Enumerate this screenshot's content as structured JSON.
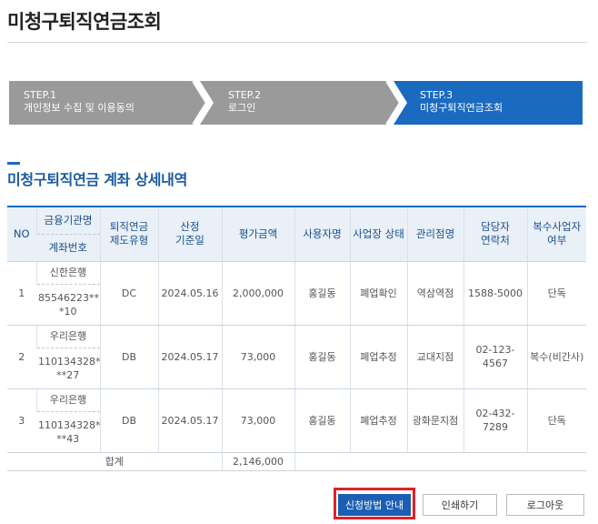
{
  "page": {
    "title": "미청구퇴직연금조회"
  },
  "steps": [
    {
      "num": "STEP.1",
      "label": "개인정보 수집 및 이용동의",
      "active": false
    },
    {
      "num": "STEP.2",
      "label": "로그인",
      "active": false
    },
    {
      "num": "STEP.3",
      "label": "미청구퇴직연금조회",
      "active": true
    }
  ],
  "colors": {
    "step_inactive": "#9a9a9a",
    "step_active": "#1a6ac0",
    "accent": "#1a5a9e",
    "highlight": "#e0202a"
  },
  "section": {
    "title": "미청구퇴직연금 계좌 상세내역"
  },
  "table": {
    "headers": {
      "no": "NO",
      "institution": "금융기관명",
      "account_no": "계좌번호",
      "plan_type": "퇴직연금 제도유형",
      "calc_date": "산정 기준일",
      "value": "평가금액",
      "user": "사용자명",
      "biz_status": "사업장 상태",
      "branch": "관리점명",
      "contact": "담당자 연락처",
      "multi": "복수사업자 여부"
    },
    "rows": [
      {
        "no": "1",
        "institution": "신한은행",
        "account_no": "85546223**\n*10",
        "plan_type": "DC",
        "calc_date": "2024.05.16",
        "value": "2,000,000",
        "user": "홍길동",
        "biz_status": "폐업확인",
        "branch": "역삼역점",
        "contact": "1588-5000",
        "multi": "단독"
      },
      {
        "no": "2",
        "institution": "우리은행",
        "account_no": "110134328*\n**27",
        "plan_type": "DB",
        "calc_date": "2024.05.17",
        "value": "73,000",
        "user": "홍길동",
        "biz_status": "폐업추정",
        "branch": "교대지점",
        "contact": "02-123-4567",
        "multi": "복수(비간사)"
      },
      {
        "no": "3",
        "institution": "우리은행",
        "account_no": "110134328*\n**43",
        "plan_type": "DB",
        "calc_date": "2024.05.17",
        "value": "73,000",
        "user": "홍길동",
        "biz_status": "폐업추정",
        "branch": "광화문지점",
        "contact": "02-432-7289",
        "multi": "단독"
      }
    ],
    "total": {
      "label": "합계",
      "value": "2,146,000"
    }
  },
  "buttons": {
    "guide": "신청방법 안내",
    "print": "인쇄하기",
    "logout": "로그아웃"
  }
}
